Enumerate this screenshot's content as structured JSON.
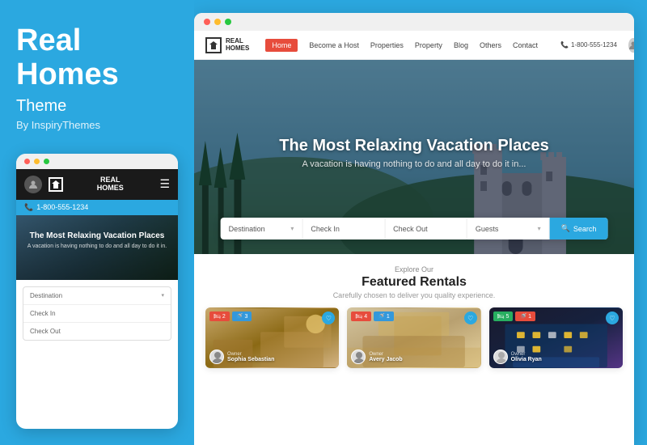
{
  "left": {
    "title_line1": "Real",
    "title_line2": "Homes",
    "subtitle": "Theme",
    "by": "By InspiryThemes",
    "large_title": "REAL HOMES"
  },
  "mobile": {
    "phone": "1-800-555-1234",
    "logo_text_line1": "REAL",
    "logo_text_line2": "HOMES",
    "hero_title": "The Most Relaxing Vacation Places",
    "hero_sub": "A vacation is having nothing to do and all day to do it in.",
    "search_fields": [
      "Destination",
      "Check In",
      "Check Out"
    ]
  },
  "desktop": {
    "dots": [
      "red",
      "yellow",
      "green"
    ],
    "logo_text_line1": "REAL",
    "logo_text_line2": "HOMES",
    "nav": {
      "items": [
        "Home",
        "Become a Host",
        "Properties",
        "Property",
        "Blog",
        "Others",
        "Contact"
      ],
      "active": "Home",
      "phone": "1-800-555-1234"
    },
    "hero": {
      "title": "The Most Relaxing Vacation Places",
      "subtitle": "A vacation is having nothing to do and all day to do it in...",
      "search": {
        "fields": [
          "Destination",
          "Check In",
          "Check Out",
          "Guests"
        ],
        "button": "Search"
      }
    },
    "featured": {
      "explore": "Explore Our",
      "title": "Featured Rentals",
      "subtitle": "Carefully chosen to deliver you quality experience.",
      "cards": [
        {
          "badges": [
            "2",
            "3"
          ],
          "badge_colors": [
            "red",
            "blue"
          ],
          "owner_label": "Owner",
          "owner_name": "Sophia Sebastian",
          "style": "interior"
        },
        {
          "badges": [
            "4",
            "1"
          ],
          "badge_colors": [
            "red",
            "blue"
          ],
          "owner_label": "Owner",
          "owner_name": "Avery Jacob",
          "style": "lounge"
        },
        {
          "badges": [
            "5",
            "1"
          ],
          "badge_colors": [
            "green",
            "red"
          ],
          "owner_label": "Owner",
          "owner_name": "Olivia Ryan",
          "style": "night"
        }
      ]
    }
  }
}
